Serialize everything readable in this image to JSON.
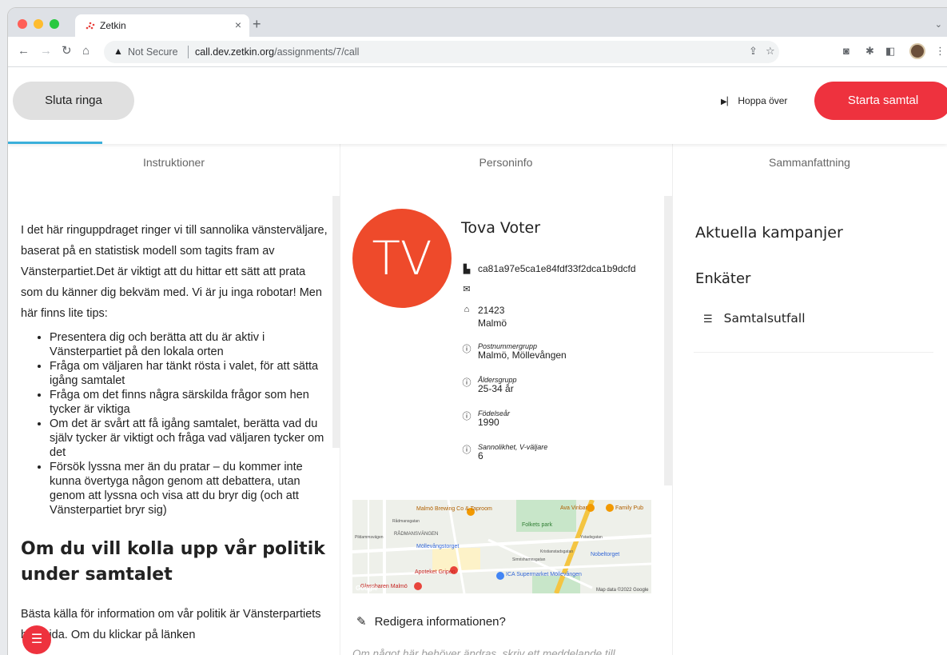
{
  "browser": {
    "tab_title": "Zetkin",
    "tab_close": "×",
    "new_tab": "+",
    "not_secure": "Not Secure",
    "url_host": "call.dev.zetkin.org",
    "url_path": "/assignments/7/call",
    "tab_menu": "⌄"
  },
  "topbar": {
    "stop_label": "Sluta ringa",
    "skip_label": "Hoppa över",
    "start_label": "Starta samtal"
  },
  "columns": {
    "instructions": "Instruktioner",
    "person": "Personinfo",
    "summary": "Sammanfattning"
  },
  "instructions": {
    "intro": "I det här ringuppdraget ringer vi till sannolika vänsterväljare, baserat på en statistisk modell som tagits fram av Vänsterpartiet.Det är viktigt att du hittar ett sätt att prata som du känner dig bekväm med. Vi är ju inga robotar! Men här finns lite tips:",
    "tips": [
      "Presentera dig och berätta att du är aktiv i Vänsterpartiet på den lokala orten",
      "Fråga om väljaren har tänkt rösta i valet, för att sätta igång samtalet",
      "Fråga om det finns några särskilda frågor som hen tycker är viktiga",
      "Om det är svårt att få igång samtalet, berätta vad du själv tycker är viktigt och fråga vad väljaren tycker om det",
      "Försök lyssna mer än du pratar – du kommer inte kunna övertyga någon genom att debattera, utan genom att lyssna och visa att du bryr dig (och att Vänsterpartiet bryr sig)"
    ],
    "heading": "Om du vill kolla upp vår politik under samtalet",
    "para2": "Bästa källa för information om vår politik är Vänsterpartiets hemsida. Om du klickar på länken"
  },
  "person": {
    "initials": "TV",
    "name": "Tova Voter",
    "id": "ca81a97e5ca1e84fdf33f2dca1b9dcfd",
    "postcode": "21423",
    "city": "Malmö",
    "fields": [
      {
        "label": "Postnummergrupp",
        "value": "Malmö, Möllevången"
      },
      {
        "label": "Åldersgrupp",
        "value": "25-34 år"
      },
      {
        "label": "Födelseår",
        "value": "1990"
      },
      {
        "label": "Sannolikhet, V-väljare",
        "value": "6"
      }
    ],
    "edit_label": "Redigera informationen?",
    "edit_note": "Om något här behöver ändras, skriv ett meddelande till"
  },
  "map": {
    "places": [
      "Malmö Brewing Co & Taproom",
      "Ava Vinbar",
      "Family Pub",
      "Folkets park",
      "RÅDMANSVÄNGEN",
      "Möllevångstorget",
      "Nobeltorget",
      "Apoteket Gripen",
      "ICA Supermarket Möllevången",
      "Glassbaren Malmö",
      "Simrishamnsgatan",
      "Kristianstadsgatan",
      "Pildammsvägen",
      "Rådmansgatan",
      "Ystadsgatan"
    ],
    "copyright": "Map data ©2022 Google",
    "logo": "Google"
  },
  "summary": {
    "campaigns": "Aktuella kampanjer",
    "surveys": "Enkäter",
    "item": "Samtalsutfall"
  },
  "colors": {
    "accent_red": "#ee323e",
    "avatar": "#ee4a2b",
    "progress": "#3bafda"
  }
}
